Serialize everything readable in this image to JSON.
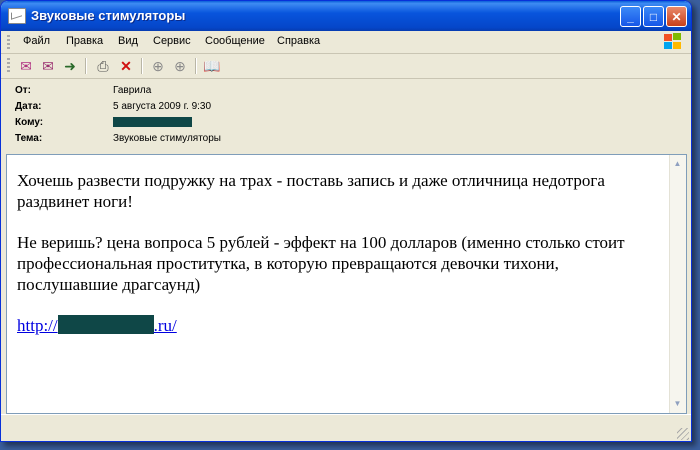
{
  "window": {
    "title": "Звуковые стимуляторы"
  },
  "menu": [
    "Файл",
    "Правка",
    "Вид",
    "Сервис",
    "Сообщение",
    "Справка"
  ],
  "toolbar": {
    "icons": [
      "reply-icon",
      "reply-all-icon",
      "forward-icon",
      "print-icon",
      "delete-icon",
      "previous-icon",
      "next-icon",
      "addresses-icon"
    ]
  },
  "headers": {
    "from_label": "От:",
    "from_value": "Гаврила",
    "date_label": "Дата:",
    "date_value": "5 августа 2009 г. 9:30",
    "to_label": "Кому:",
    "subject_label": "Тема:",
    "subject_value": "Звуковые стимуляторы"
  },
  "message": {
    "p1": "Хочешь развести подружку на трах - поставь запись и даже отличница недотрога раздвинет ноги!",
    "p2": "Не веришь? цена вопроса 5 рублей - эффект на 100 долларов (именно столько стоит профессиональная проститутка, в которую превращаются девочки тихони, послушавшие драгсаунд)",
    "link_prefix": "http://",
    "link_suffix": ".ru/"
  },
  "colors": {
    "redaction": "#0f4747",
    "link": "#0000e0",
    "titlebar": "#0855dd"
  }
}
